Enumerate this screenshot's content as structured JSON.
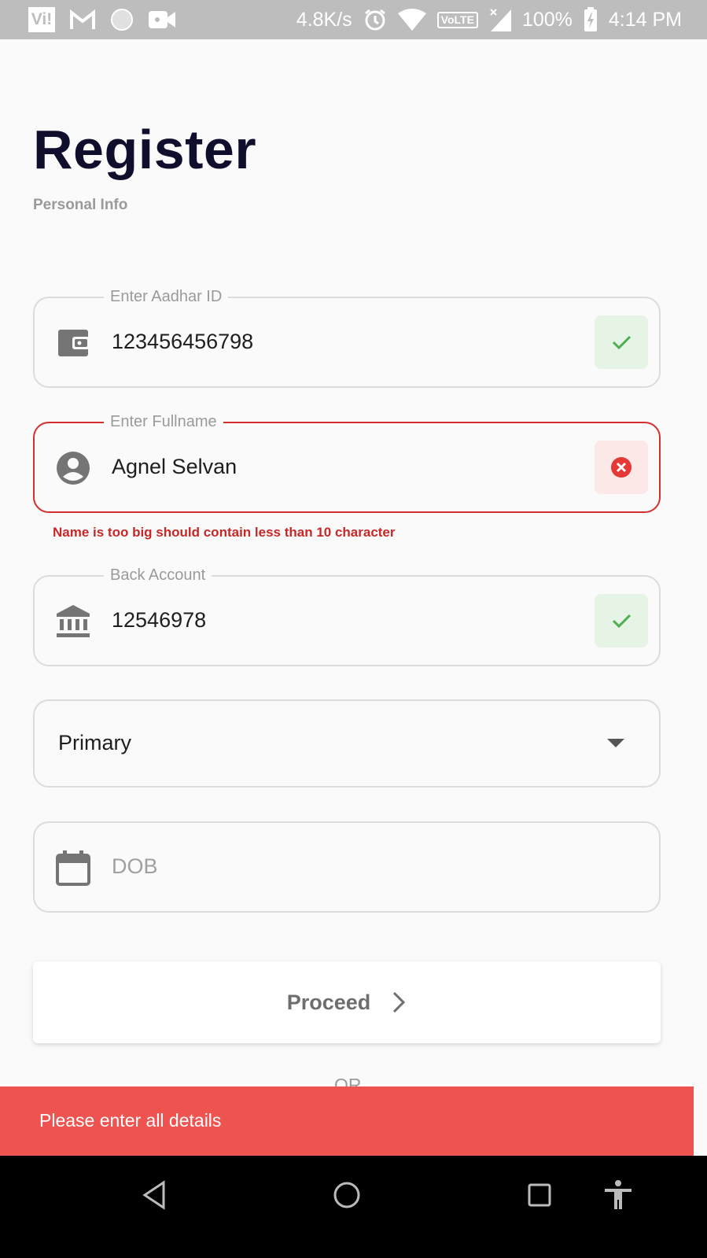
{
  "status_bar": {
    "carrier_logo": "Vi!",
    "speed": "4.8K/s",
    "network_badge": "VoLTE",
    "battery": "100%",
    "time": "4:14 PM",
    "icons": [
      "vi-logo",
      "gmail-icon",
      "circle-icon",
      "video-icon",
      "alarm-icon",
      "wifi-icon",
      "volte-icon",
      "signal-icon",
      "battery-charging-icon"
    ]
  },
  "header": {
    "title": "Register",
    "subtitle": "Personal Info"
  },
  "form": {
    "aadhar": {
      "label": "Enter Aadhar ID",
      "value": "123456456798",
      "icon": "wallet-icon",
      "status": "valid"
    },
    "fullname": {
      "label": "Enter Fullname",
      "value": "Agnel Selvan",
      "icon": "account-circle-icon",
      "status": "invalid",
      "error": "Name is too big should contain less than 10 character"
    },
    "account": {
      "label": "Back Account",
      "value": "12546978",
      "icon": "bank-icon",
      "status": "valid"
    },
    "account_type": {
      "value": "Primary",
      "icon": "dropdown-arrow-icon"
    },
    "dob": {
      "placeholder": "DOB",
      "icon": "calendar-icon"
    }
  },
  "actions": {
    "proceed_label": "Proceed",
    "or_label": "OR"
  },
  "snackbar": {
    "message": "Please enter all details"
  },
  "colors": {
    "title": "#0f0f2d",
    "error": "#d32f2f",
    "success": "#4caf50",
    "snackbar": "#ef5350",
    "status_bar": "#bdbdbd"
  }
}
